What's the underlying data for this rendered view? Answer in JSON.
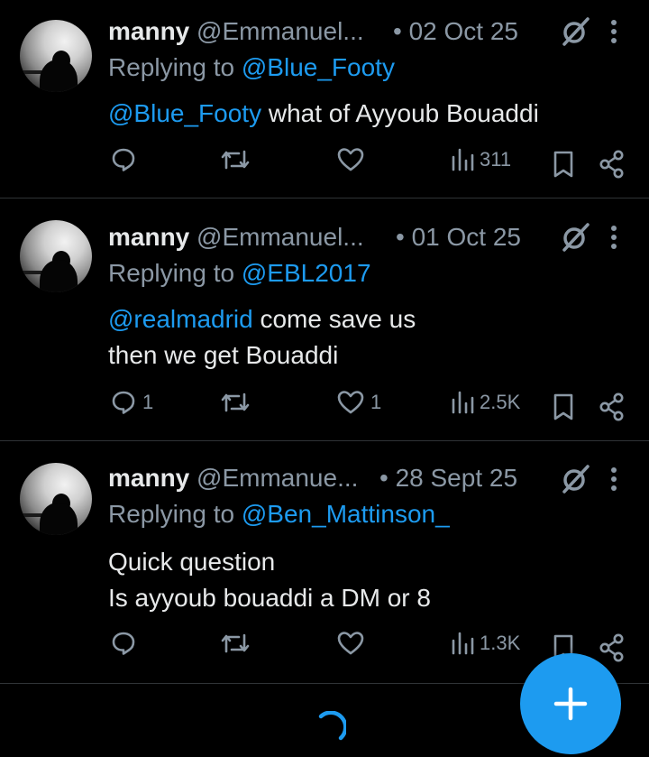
{
  "tweets": [
    {
      "name": "manny",
      "handle": "@Emmanuel...",
      "date": "• 02 Oct 25",
      "replying_prefix": "Replying to ",
      "replying_to": "@Blue_Footy",
      "body_lines": [
        {
          "mention": "@Blue_Footy",
          "text": " what of Ayyoub Bouaddi"
        }
      ],
      "replies": "",
      "likes": "",
      "views": "311"
    },
    {
      "name": "manny",
      "handle": "@Emmanuel...",
      "date": "• 01 Oct 25",
      "replying_prefix": "Replying to ",
      "replying_to": "@EBL2017",
      "body_lines": [
        {
          "mention": "@realmadrid",
          "text": " come save us"
        },
        {
          "mention": "",
          "text": "then we get Bouaddi"
        }
      ],
      "replies": "1",
      "likes": "1",
      "views": "2.5K"
    },
    {
      "name": "manny",
      "handle": "@Emmanue...",
      "date": "• 28 Sept 25",
      "replying_prefix": "Replying to ",
      "replying_to": "@Ben_Mattinson_",
      "body_lines": [
        {
          "mention": "",
          "text": "Quick question"
        },
        {
          "mention": "",
          "text": "Is ayyoub bouaddi a DM or 8"
        }
      ],
      "replies": "",
      "likes": "",
      "views": "1.3K"
    }
  ],
  "icons": {
    "reply": "reply-icon",
    "retweet": "retweet-icon",
    "like": "heart-icon",
    "views": "views-icon",
    "bookmark": "bookmark-icon",
    "share": "share-icon",
    "grok": "grok-icon",
    "more": "more-icon",
    "compose": "plus-icon",
    "loading": "spinner-icon"
  },
  "colors": {
    "background": "#000000",
    "text": "#e7e9ea",
    "secondary": "#8b98a5",
    "accent": "#1d9bf0",
    "divider": "#2f3336"
  }
}
